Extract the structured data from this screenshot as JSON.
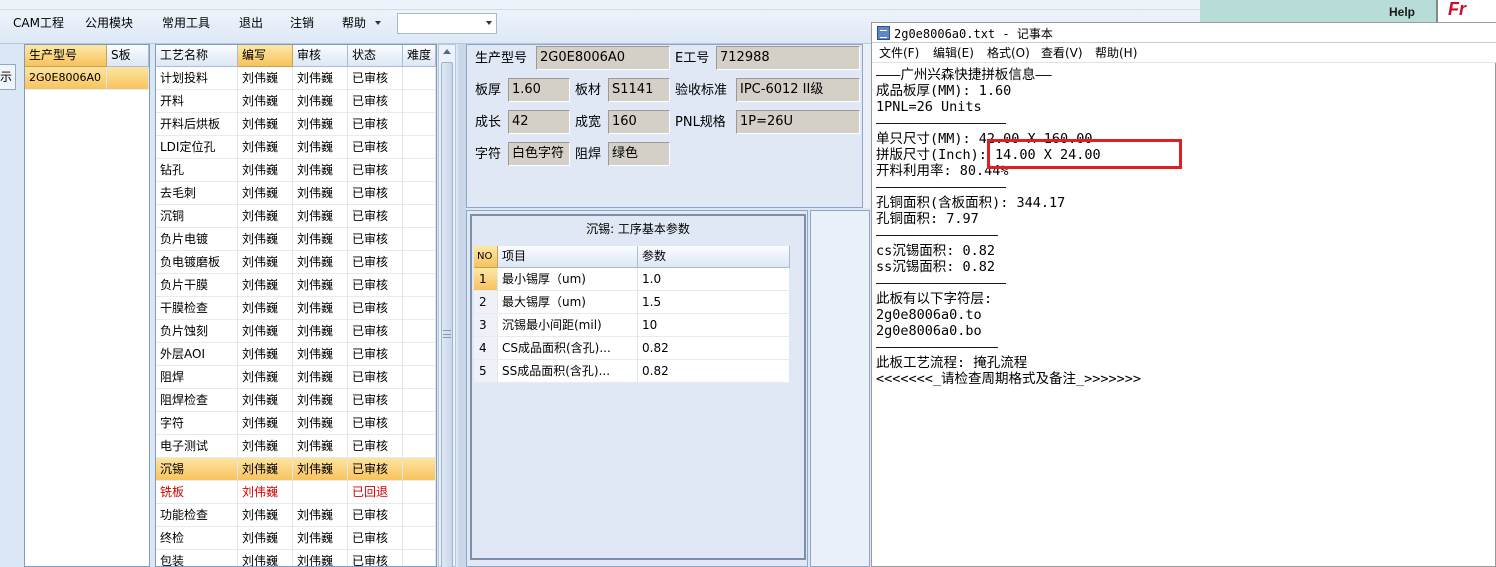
{
  "menubar": {
    "items": [
      "CAM工程",
      "公用模块",
      "常用工具",
      "退出",
      "注销",
      "帮助"
    ],
    "combo_value": ""
  },
  "topright": {
    "help": "Help",
    "brand": "Fr"
  },
  "left_stub": "示",
  "model_grid": {
    "headers": [
      "生产型号",
      "S板"
    ],
    "rows": [
      [
        "2G0E8006A0",
        ""
      ]
    ]
  },
  "process_grid": {
    "headers": [
      "工艺名称",
      "编写",
      "审核",
      "状态",
      "难度"
    ],
    "rows": [
      [
        "计划投料",
        "刘伟巍",
        "刘伟巍",
        "已审核",
        ""
      ],
      [
        "开料",
        "刘伟巍",
        "刘伟巍",
        "已审核",
        ""
      ],
      [
        "开料后烘板",
        "刘伟巍",
        "刘伟巍",
        "已审核",
        ""
      ],
      [
        "LDI定位孔",
        "刘伟巍",
        "刘伟巍",
        "已审核",
        ""
      ],
      [
        "钻孔",
        "刘伟巍",
        "刘伟巍",
        "已审核",
        ""
      ],
      [
        "去毛刺",
        "刘伟巍",
        "刘伟巍",
        "已审核",
        ""
      ],
      [
        "沉铜",
        "刘伟巍",
        "刘伟巍",
        "已审核",
        ""
      ],
      [
        "负片电镀",
        "刘伟巍",
        "刘伟巍",
        "已审核",
        ""
      ],
      [
        "负电镀磨板",
        "刘伟巍",
        "刘伟巍",
        "已审核",
        ""
      ],
      [
        "负片干膜",
        "刘伟巍",
        "刘伟巍",
        "已审核",
        ""
      ],
      [
        "干膜检查",
        "刘伟巍",
        "刘伟巍",
        "已审核",
        ""
      ],
      [
        "负片蚀刻",
        "刘伟巍",
        "刘伟巍",
        "已审核",
        ""
      ],
      [
        "外层AOI",
        "刘伟巍",
        "刘伟巍",
        "已审核",
        ""
      ],
      [
        "阻焊",
        "刘伟巍",
        "刘伟巍",
        "已审核",
        ""
      ],
      [
        "阻焊检查",
        "刘伟巍",
        "刘伟巍",
        "已审核",
        ""
      ],
      [
        "字符",
        "刘伟巍",
        "刘伟巍",
        "已审核",
        ""
      ],
      [
        "电子测试",
        "刘伟巍",
        "刘伟巍",
        "已审核",
        ""
      ],
      [
        "沉锡",
        "刘伟巍",
        "刘伟巍",
        "已审核",
        ""
      ],
      [
        "铣板",
        "刘伟巍",
        "",
        "已回退",
        ""
      ],
      [
        "功能检查",
        "刘伟巍",
        "刘伟巍",
        "已审核",
        ""
      ],
      [
        "终检",
        "刘伟巍",
        "刘伟巍",
        "已审核",
        ""
      ],
      [
        "包装",
        "刘伟巍",
        "刘伟巍",
        "已审核",
        ""
      ]
    ],
    "selected_index": 17,
    "rejected_index": 18
  },
  "info": {
    "model_label": "生产型号",
    "model_value": "2G0E8006A0",
    "eno_label": "E工号",
    "eno_value": "712988",
    "thick_label": "板厚",
    "thick_value": "1.60",
    "material_label": "板材",
    "material_value": "S1141",
    "accept_label": "验收标准",
    "accept_value": "IPC-6012 II级",
    "length_label": "成长",
    "length_value": "42",
    "width_label": "成宽",
    "width_value": "160",
    "pnl_label": "PNL规格",
    "pnl_value": "1P=26U",
    "char_label": "字符",
    "char_value": "白色字符",
    "mask_label": "阻焊",
    "mask_value": "绿色"
  },
  "params": {
    "title": "沉锡: 工序基本参数",
    "headers": [
      "NO",
      "项目",
      "参数"
    ],
    "rows": [
      [
        "1",
        "最小锡厚（um)",
        "1.0"
      ],
      [
        "2",
        "最大锡厚（um)",
        "1.5"
      ],
      [
        "3",
        "沉锡最小间距(mil)",
        "10"
      ],
      [
        "4",
        "CS成品面积(含孔)...",
        "0.82"
      ],
      [
        "5",
        "SS成品面积(含孔)...",
        "0.82"
      ]
    ]
  },
  "notepad": {
    "title": "2g0e8006a0.txt - 记事本",
    "menu": [
      "文件(F)",
      "编辑(E)",
      "格式(O)",
      "查看(V)",
      "帮助(H)"
    ],
    "lines": [
      "———广州兴森快捷拼板信息——",
      "成品板厚(MM): 1.60",
      "1PNL=26 Units",
      "————————————————",
      "单只尺寸(MM): 42.00 X 160.00",
      "拼版尺寸(Inch): 14.00 X 24.00",
      "开料利用率: 80.44%",
      "————————————————",
      "孔铜面积(含板面积): 344.17",
      "孔铜面积: 7.97",
      "———————————————",
      "cs沉锡面积: 0.82",
      "ss沉锡面积: 0.82",
      "————————————————",
      "此板有以下字符层:",
      "2g0e8006a0.to",
      "2g0e8006a0.bo",
      "———————————————",
      "此板工艺流程: 掩孔流程",
      "<<<<<<<_请检查周期格式及备注_>>>>>>>"
    ]
  },
  "colors": {
    "highlight_border": "#e02020",
    "rejected_text": "#d40000",
    "selected_row": "#f8c35e"
  }
}
